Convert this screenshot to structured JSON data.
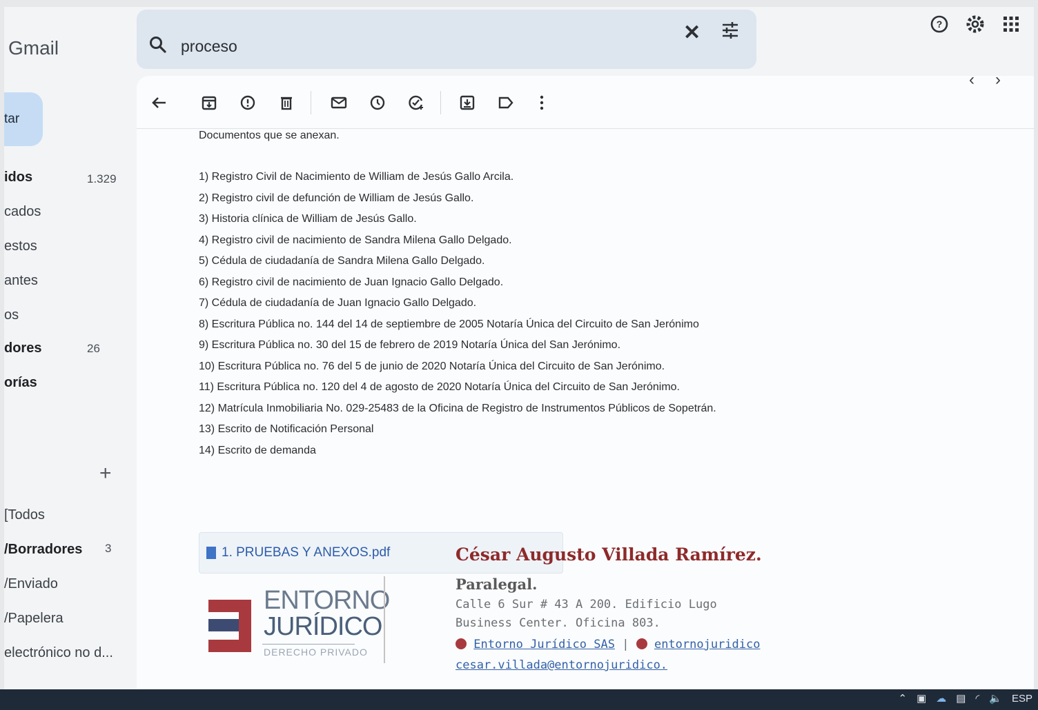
{
  "app": {
    "brand": "Gmail"
  },
  "search": {
    "query": "proceso"
  },
  "compose": {
    "label": "tar"
  },
  "nav": [
    {
      "label": "idos",
      "count": "1.329",
      "bold": true
    },
    {
      "label": "cados",
      "count": "",
      "bold": false
    },
    {
      "label": "estos",
      "count": "",
      "bold": false
    },
    {
      "label": "antes",
      "count": "",
      "bold": false
    },
    {
      "label": "os",
      "count": "",
      "bold": false
    },
    {
      "label": "dores",
      "count": "26",
      "bold": true
    },
    {
      "label": "orías",
      "count": "",
      "bold": true
    },
    {
      "label": "[Todos",
      "count": "",
      "bold": false
    },
    {
      "label": "/Borradores",
      "count": "3",
      "bold": true
    },
    {
      "label": "/Enviado",
      "count": "",
      "bold": false
    },
    {
      "label": "/Papelera",
      "count": "",
      "bold": false
    },
    {
      "label": "electrónico no d...",
      "count": "",
      "bold": false
    }
  ],
  "email": {
    "intro": "Documentos que se anexan.",
    "items": [
      "1) Registro Civil de Nacimiento de William de Jesús Gallo Arcila.",
      "2) Registro civil de defunción de William de Jesús Gallo.",
      "3) Historia clínica de William de Jesús Gallo.",
      "4) Registro civil de nacimiento de Sandra Milena Gallo Delgado.",
      "5) Cédula de ciudadanía de Sandra Milena Gallo Delgado.",
      "6) Registro civil de nacimiento de Juan Ignacio Gallo Delgado.",
      "7) Cédula de ciudadanía de Juan Ignacio Gallo Delgado.",
      "8) Escritura Pública no. 144 del 14 de septiembre de 2005 Notaría Única del Circuito de San Jerónimo",
      "9) Escritura Pública no. 30 del 15 de febrero de 2019 Notaría Única del San Jerónimo.",
      "10) Escritura Pública no. 76 del 5 de junio de 2020 Notaría Única del Circuito de San Jerónimo.",
      "11) Escritura Pública no. 120 del 4 de agosto de 2020 Notaría Única del Circuito de San Jerónimo.",
      "12) Matrícula Inmobiliaria No. 029-25483 de la Oficina de Registro de Instrumentos Públicos de Sopetrán.",
      "13) Escrito de Notificación Personal",
      "14) Escrito de demanda"
    ],
    "attachment": "1. PRUEBAS Y ANEXOS.pdf"
  },
  "signature": {
    "logo_line1": "ENTORNO",
    "logo_line2": "JURÍDICO",
    "logo_line3": "DERECHO PRIVADO",
    "name": "César Augusto Villada Ramírez.",
    "role": "Paralegal.",
    "address": "Calle 6 Sur # 43 A 200. Edificio Lugo Business Center. Oficina 803.",
    "facebook": "Entorno Jurídico SAS",
    "instagram": "entornojuridico",
    "email": "cesar.villada@entornojuridico."
  },
  "taskbar": {
    "lang": "ESP"
  },
  "colors": {
    "accent_red": "#8e2a2a",
    "link_blue": "#3261a8",
    "search_bg": "#dde5ef",
    "compose_bg": "#c5dcf4"
  }
}
